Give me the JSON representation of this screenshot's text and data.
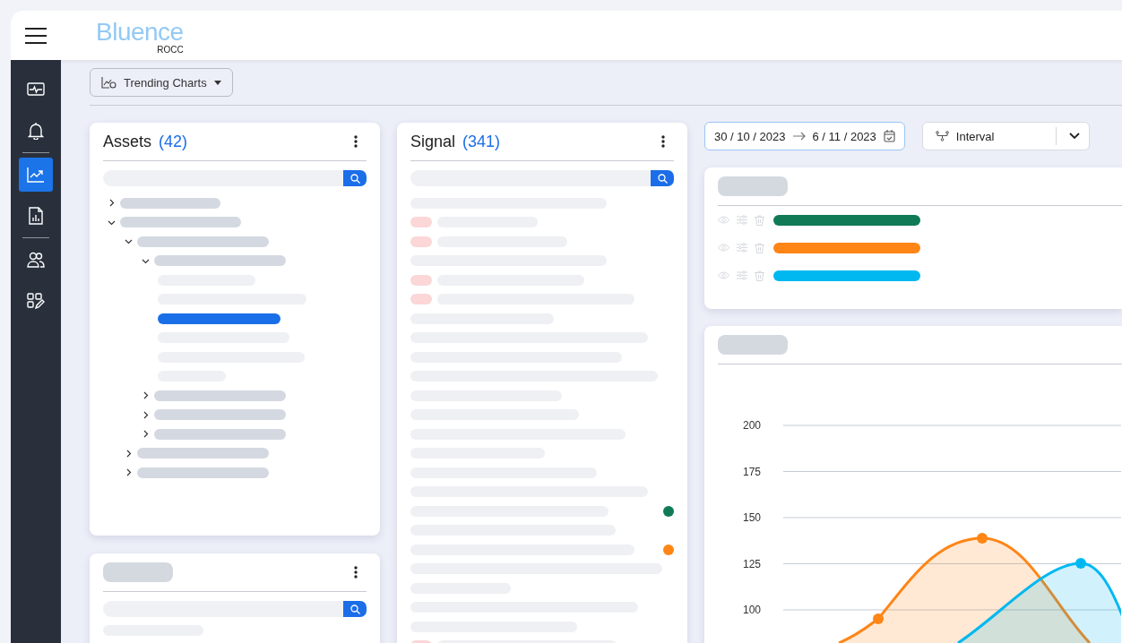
{
  "header": {
    "logo": "Bluence",
    "sublogo": "ROCC"
  },
  "sidebar": {
    "items": [
      {
        "selected": false
      },
      {
        "selected": false
      },
      {
        "selected": true
      },
      {
        "selected": false
      },
      {
        "selected": false
      },
      {
        "selected": false
      }
    ]
  },
  "toolbar": {
    "view_button": "Trending Charts"
  },
  "assets": {
    "title": "Assets",
    "count": "(42)",
    "tree": [
      {
        "expanded": false
      },
      {
        "expanded": true,
        "children": [
          {
            "expanded": true,
            "children": [
              {
                "expanded": true,
                "children": [
                  {
                    "selected": false
                  },
                  {
                    "selected": false
                  },
                  {
                    "selected": true
                  },
                  {
                    "selected": false
                  },
                  {
                    "selected": false
                  },
                  {
                    "selected": false
                  }
                ]
              },
              {
                "expanded": false
              },
              {
                "expanded": false
              },
              {
                "expanded": false
              }
            ]
          },
          {
            "expanded": false
          },
          {
            "expanded": false
          }
        ]
      }
    ]
  },
  "signal": {
    "title": "Signal",
    "count": "(341)",
    "rows": [
      {
        "flagged": false
      },
      {
        "flagged": true
      },
      {
        "flagged": true
      },
      {
        "flagged": false
      },
      {
        "flagged": true
      },
      {
        "flagged": true
      },
      {
        "flagged": false
      },
      {
        "flagged": false
      },
      {
        "flagged": false
      },
      {
        "flagged": false
      },
      {
        "flagged": false
      },
      {
        "flagged": false
      },
      {
        "flagged": false
      },
      {
        "flagged": false
      },
      {
        "flagged": false
      },
      {
        "flagged": false
      },
      {
        "flagged": false,
        "color": "#107a56"
      },
      {
        "flagged": false
      },
      {
        "flagged": false,
        "color": "#ff8515"
      },
      {
        "flagged": false
      },
      {
        "flagged": false
      },
      {
        "flagged": false
      },
      {
        "flagged": false
      },
      {
        "flagged": true
      }
    ]
  },
  "date_range": {
    "start": "30 / 10 / 2023",
    "end": "6 / 11 / 2023"
  },
  "interval": {
    "value": "Interval"
  },
  "legend": [
    {
      "color": "#107a56"
    },
    {
      "color": "#ff8515"
    },
    {
      "color": "#00b8f0"
    }
  ],
  "chart": {
    "y_labels": [
      "200",
      "175",
      "150",
      "125",
      "100"
    ],
    "series": [
      {
        "color": "#ff8515"
      },
      {
        "color": "#00b8f0"
      }
    ]
  }
}
